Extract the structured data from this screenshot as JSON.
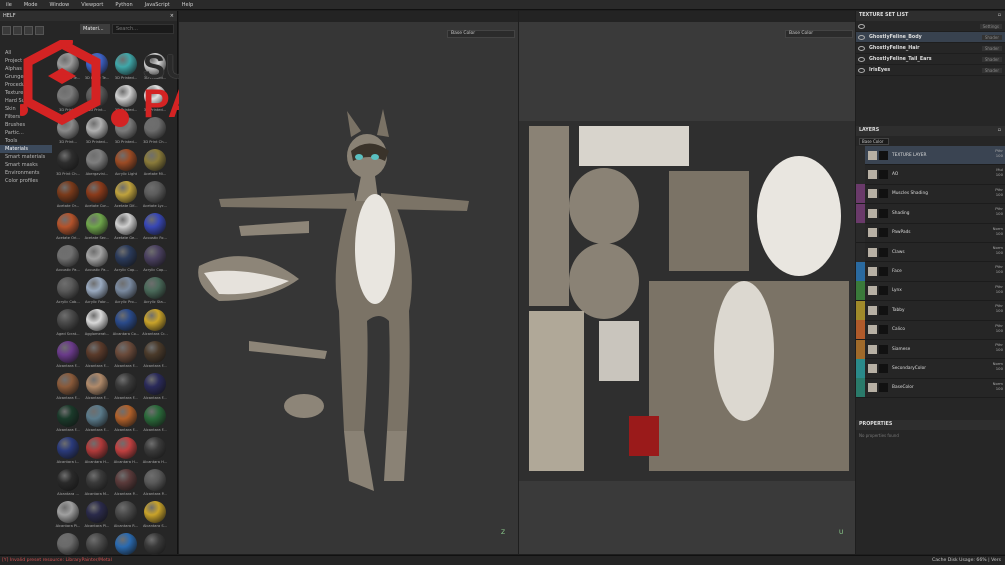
{
  "menu": [
    "ile",
    "Mode",
    "Window",
    "Viewport",
    "Python",
    "JavaScript",
    "Help"
  ],
  "shelf": {
    "title": "HELF",
    "active_tab": "Materi...",
    "search_placeholder": "Search...",
    "categories": [
      "All",
      "Project",
      "Alphas",
      "Grunges",
      "Procedur...",
      "Textures",
      "Hard Sur...",
      "Skin",
      "Filters",
      "Brushes",
      "Partic...",
      "Tools",
      "Materials",
      "Smart materials",
      "Smart masks",
      "Environments",
      "Color profiles"
    ],
    "active_category": "Materials",
    "materials": [
      {
        "label": "3D Noise Te...",
        "color": "#9a9a9a"
      },
      {
        "label": "3D Noise Te...",
        "color": "#3d63c9"
      },
      {
        "label": "3D Printed...",
        "color": "#3fa7a9"
      },
      {
        "label": "3D Printed...",
        "color": "#d9d9d9"
      },
      {
        "label": "3D Print...",
        "color": "#7a7a7a"
      },
      {
        "label": "3D Print...",
        "color": "#5a5a5a"
      },
      {
        "label": "3D Printed...",
        "color": "#cfcfcf"
      },
      {
        "label": "3D Printed...",
        "color": "#e0e0e0"
      },
      {
        "label": "3D Print...",
        "color": "#8a8a8a"
      },
      {
        "label": "3D Printed...",
        "color": "#b0b0b0"
      },
      {
        "label": "3D Printed...",
        "color": "#7b7b7b"
      },
      {
        "label": "3D Print Ch...",
        "color": "#6c6c6c"
      },
      {
        "label": "3D Print Ch...",
        "color": "#2d2d2d"
      },
      {
        "label": "Abergavini...",
        "color": "#7f7f7f"
      },
      {
        "label": "Acrylic Light",
        "color": "#9c4b24"
      },
      {
        "label": "Acetate Mi...",
        "color": "#8a7b3a"
      },
      {
        "label": "Acetate Or...",
        "color": "#7a3a1a"
      },
      {
        "label": "Acetate Cor...",
        "color": "#8a3a1a"
      },
      {
        "label": "Acetate Dif...",
        "color": "#bfa23d"
      },
      {
        "label": "Acetate Lyc...",
        "color": "#5c5c5c"
      },
      {
        "label": "Acetate Ori...",
        "color": "#b4532b"
      },
      {
        "label": "Acetate Sec...",
        "color": "#6fa64b"
      },
      {
        "label": "Acetate Ge...",
        "color": "#cfcfcf"
      },
      {
        "label": "Acoustic Fo...",
        "color": "#3847b5"
      },
      {
        "label": "Acoustic Pa...",
        "color": "#6f6f6f"
      },
      {
        "label": "Acoustic Pa...",
        "color": "#a3a3a3"
      },
      {
        "label": "Acrylic Cap...",
        "color": "#2a3a5a"
      },
      {
        "label": "Acrylic Cap...",
        "color": "#4a4060"
      },
      {
        "label": "Acrylic Cob...",
        "color": "#5a5a5a"
      },
      {
        "label": "Acrylic Fabr...",
        "color": "#9aaac0"
      },
      {
        "label": "Acrylic Pro...",
        "color": "#7a8aa0"
      },
      {
        "label": "Acrylic Sta...",
        "color": "#4a6a5a"
      },
      {
        "label": "Aged Scrat...",
        "color": "#4a4a4a"
      },
      {
        "label": "Agglomerat...",
        "color": "#d9d9d9"
      },
      {
        "label": "Alcantara Co...",
        "color": "#2a4a8a"
      },
      {
        "label": "Alcantara Cr...",
        "color": "#c9a32a"
      },
      {
        "label": "Alcantara F...",
        "color": "#6a3a8a"
      },
      {
        "label": "Alcantara F...",
        "color": "#5a3a2a"
      },
      {
        "label": "Alcantara F...",
        "color": "#6a4a3a"
      },
      {
        "label": "Alcantara F...",
        "color": "#4a3a2a"
      },
      {
        "label": "Alcantara F...",
        "color": "#8a5a3a"
      },
      {
        "label": "Alcantara F...",
        "color": "#b08a6a"
      },
      {
        "label": "Alcantara F...",
        "color": "#3a3a3a"
      },
      {
        "label": "Alcantara F...",
        "color": "#2a2a5a"
      },
      {
        "label": "Alcantara F...",
        "color": "#1a3a2a"
      },
      {
        "label": "Alcantara F...",
        "color": "#5a7a8a"
      },
      {
        "label": "Alcantara F...",
        "color": "#b0602a"
      },
      {
        "label": "Alcantara F...",
        "color": "#2a6a3a"
      },
      {
        "label": "Alcantara I...",
        "color": "#2a3a7a"
      },
      {
        "label": "Alcantara H...",
        "color": "#b03a3a"
      },
      {
        "label": "Alcantara H...",
        "color": "#c04040"
      },
      {
        "label": "Alcantara H...",
        "color": "#3a3a3a"
      },
      {
        "label": "Alcantara ...",
        "color": "#2a2a2a"
      },
      {
        "label": "Alcantara M...",
        "color": "#3a3a3a"
      },
      {
        "label": "Alcantara P...",
        "color": "#5a3a3a"
      },
      {
        "label": "Alcantara P...",
        "color": "#5a5a5a"
      },
      {
        "label": "Alcantara Pi...",
        "color": "#a0a0a0"
      },
      {
        "label": "Alcantara Pl...",
        "color": "#2a2a4a"
      },
      {
        "label": "Alcantara R...",
        "color": "#4a4a4a"
      },
      {
        "label": "Alcantara S...",
        "color": "#c9a32a"
      },
      {
        "label": "Alcantara St...",
        "color": "#6a6a6a"
      },
      {
        "label": "Alcantara Su...",
        "color": "#4a4a4a"
      },
      {
        "label": "Alcantara Te...",
        "color": "#2a6ab0"
      },
      {
        "label": "Alcantara T...",
        "color": "#3a3a3a"
      }
    ]
  },
  "logo": {
    "line1": "SUBSTANCE",
    "line2": "PAINTER"
  },
  "viewport3d": {
    "channel": "Base Color",
    "axis": "Z"
  },
  "viewport2d": {
    "channel": "Base Color",
    "axis": "U"
  },
  "texture_sets": {
    "title": "TEXTURE SET LIST",
    "settings": "Settings",
    "items": [
      {
        "name": "GhostlyFeline_Body",
        "active": true
      },
      {
        "name": "GhostlyFeline_Hair",
        "active": false
      },
      {
        "name": "GhostlyFeline_Tail_Ears",
        "active": false
      },
      {
        "name": "IrisEyes",
        "active": false
      }
    ],
    "button": "Shader"
  },
  "layers": {
    "title": "LAYERS",
    "channel": "Base Color",
    "items": [
      {
        "name": "TEXTURE LAYER",
        "blend": "Pthr\n100",
        "stripe": "#2a2a2a",
        "active": true
      },
      {
        "name": "AO",
        "blend": "Mul\n100",
        "stripe": "#2a2a2a",
        "active": false
      },
      {
        "name": "Muscles Shading",
        "blend": "Pthr\n100",
        "stripe": "#6a3a6a",
        "active": false
      },
      {
        "name": "Shading",
        "blend": "Pthr\n100",
        "stripe": "#6a3a6a",
        "active": false
      },
      {
        "name": "PawPads",
        "blend": "Norm\n100",
        "stripe": "#2a2a2a",
        "active": false
      },
      {
        "name": "Claws",
        "blend": "Norm\n100",
        "stripe": "#2a2a2a",
        "active": false
      },
      {
        "name": "Face",
        "blend": "Pthr\n100",
        "stripe": "#2a6aa0",
        "active": false
      },
      {
        "name": "Lynx",
        "blend": "Pthr\n100",
        "stripe": "#3a7a3a",
        "active": false
      },
      {
        "name": "Tabby",
        "blend": "Pthr\n100",
        "stripe": "#a08a2a",
        "active": false
      },
      {
        "name": "Calico",
        "blend": "Pthr\n100",
        "stripe": "#b05a2a",
        "active": false
      },
      {
        "name": "Siamese",
        "blend": "Pthr\n100",
        "stripe": "#a06a2a",
        "active": false
      },
      {
        "name": "SecondaryColor",
        "blend": "Norm\n100",
        "stripe": "#2a8a8a",
        "active": false
      },
      {
        "name": "BaseColor",
        "blend": "Norm\n100",
        "stripe": "#2a7a6a",
        "active": false
      }
    ]
  },
  "properties": {
    "title": "PROPERTIES",
    "empty_text": "No properties found"
  },
  "status": {
    "left": "[Y] Invalid preset resource: LibraryPainter/Metal",
    "right": "Cache Disk Usage:  66% | Vers"
  }
}
